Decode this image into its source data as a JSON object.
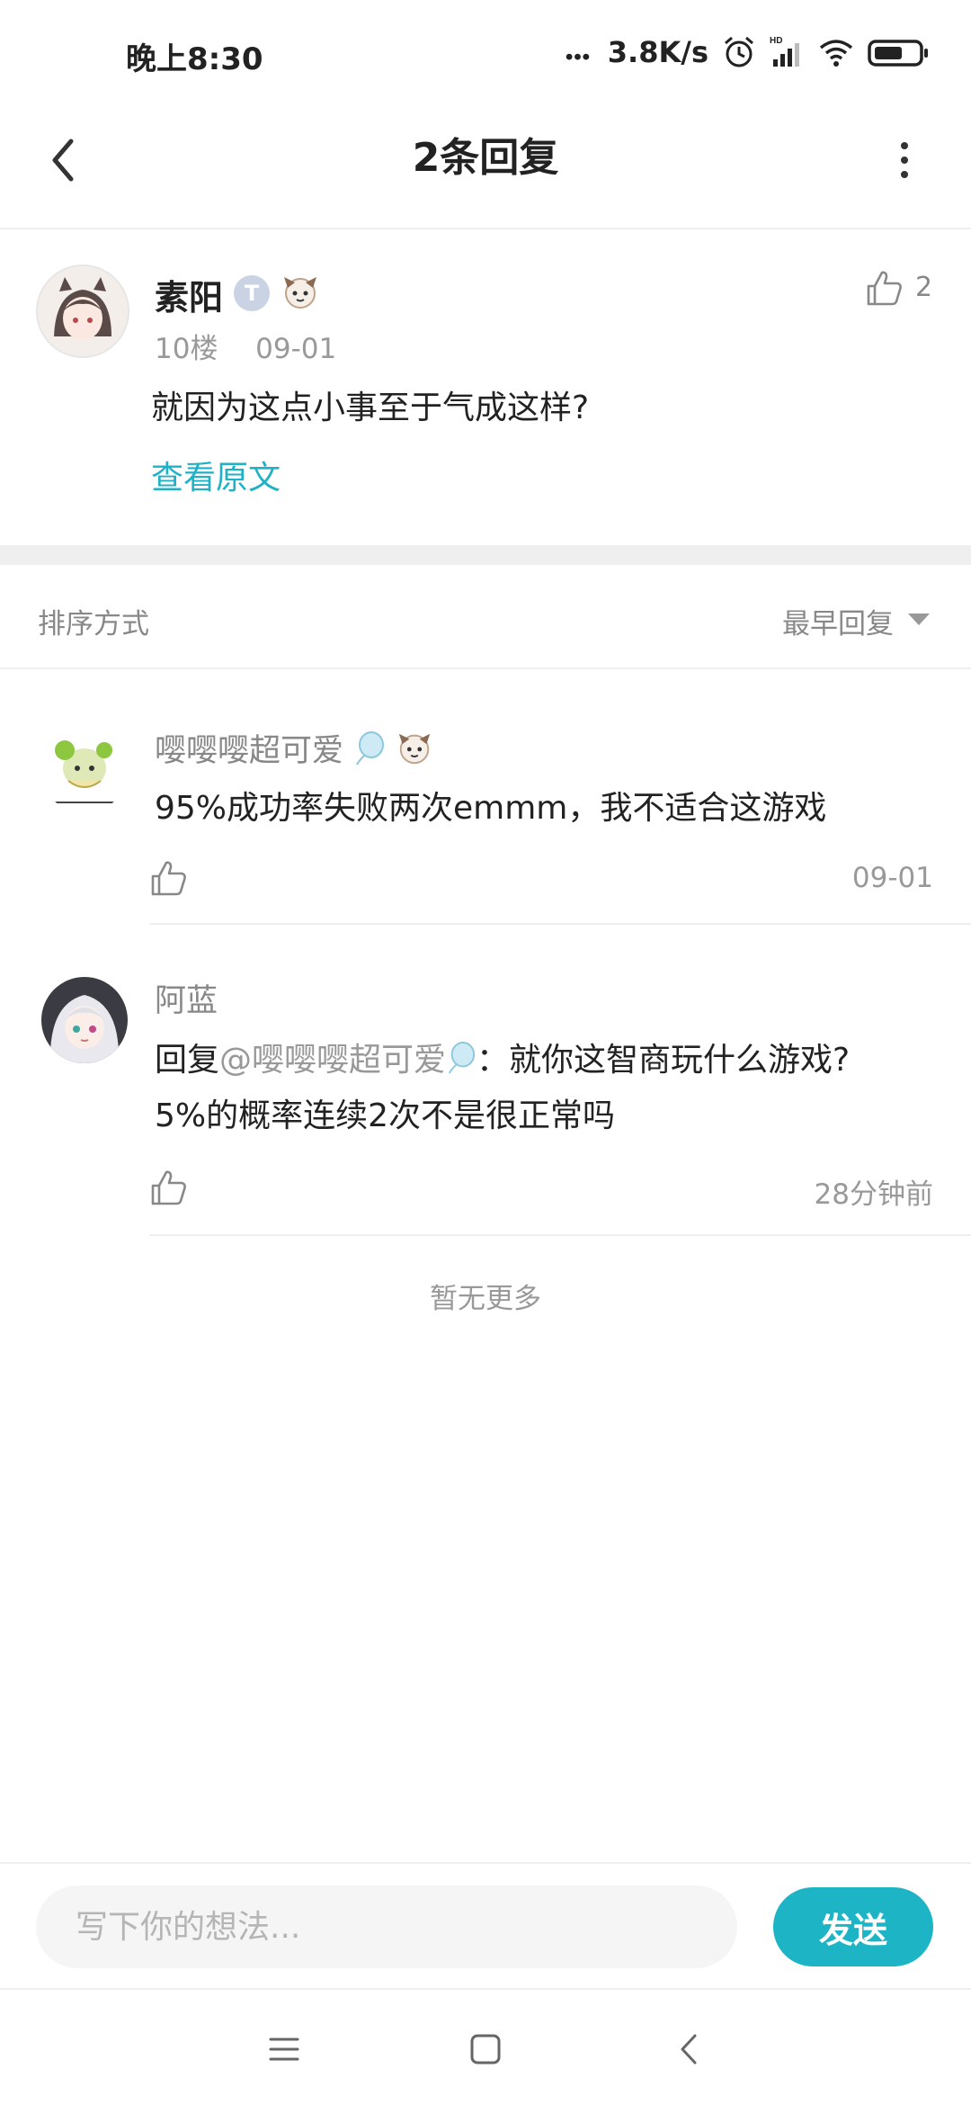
{
  "status_bar": {
    "time": "晚上8:30",
    "network_speed": "3.8K/s",
    "icons": [
      "dots-icon",
      "alarm-icon",
      "signal-icon",
      "wifi-icon",
      "battery-icon"
    ]
  },
  "header": {
    "title": "2条回复"
  },
  "main_post": {
    "user_name": "素阳",
    "level_badge": "T",
    "floor": "10楼",
    "date": "09-01",
    "likes": "2",
    "text": "就因为这点小事至于气成这样?",
    "view_original": "查看原文"
  },
  "sort": {
    "label": "排序方式",
    "value": "最早回复"
  },
  "replies": [
    {
      "name": "嘤嘤嘤超可爱",
      "text": "95%成功率失败两次emmm，我不适合这游戏",
      "time": "09-01"
    },
    {
      "name": "阿蓝",
      "reply_prefix": "回复",
      "mention": "@嘤嘤嘤超可爱",
      "text_after": "：就你这智商玩什么游戏?",
      "text_line2": "5%的概率连续2次不是很正常吗",
      "time": "28分钟前"
    }
  ],
  "footer_note": "暂无更多",
  "input": {
    "placeholder": "写下你的想法...",
    "send_label": "发送"
  },
  "colors": {
    "accent": "#1db5c6",
    "link": "#1fb2c7",
    "muted": "#999999",
    "divider": "#efefef"
  }
}
